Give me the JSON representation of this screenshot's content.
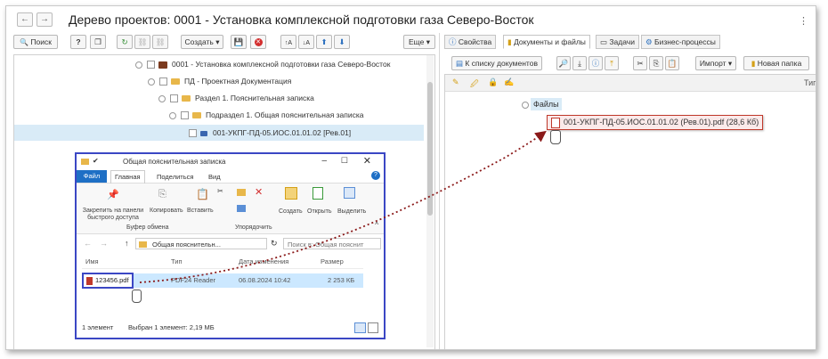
{
  "window": {
    "title": "Дерево проектов: 0001 - Установка комплексной подготовки газа Северо-Восток",
    "nav_back": "←",
    "nav_forward": "→"
  },
  "left_toolbar": {
    "search": "Поиск",
    "help": "?",
    "create": "Создать",
    "more": "Еще"
  },
  "tree": {
    "root": "0001 - Установка комплексной подготовки газа Северо-Восток",
    "pd": "ПД - Проектная Документация",
    "section": "Раздел 1. Пояснительная записка",
    "subsection": "Подраздел 1. Общая пояснительная записка",
    "document": "001-УКПГ-ПД-05.ИОС.01.01.02 [Рев.01]"
  },
  "right_tabs": [
    "Свойства",
    "Документы и файлы",
    "Задачи",
    "Бизнес-процессы"
  ],
  "right_toolbar": {
    "to_list": "К списку документов",
    "import": "Импорт",
    "new_folder": "Новая папка"
  },
  "files": {
    "header": "Файлы",
    "type_col": "Тип",
    "item": "001-УКПГ-ПД-05.ИОС.01.01.02 (Рев.01).pdf (28,6 Кб)"
  },
  "explorer": {
    "title": "Общая пояснительная записка",
    "menu": [
      "Файл",
      "Главная",
      "Поделиться",
      "Вид"
    ],
    "ribbon": {
      "pin": "Закрепить на панели быстрого доступа",
      "copy": "Копировать",
      "paste": "Вставить",
      "create": "Создать",
      "open": "Открыть",
      "select": "Выделить",
      "group_clipboard": "Буфер обмена",
      "group_organize": "Упорядочить"
    },
    "address": "Общая пояснительн...",
    "search_placeholder": "Поиск в: Общая пояснит",
    "columns": [
      "Имя",
      "Тип",
      "Дата изменения",
      "Размер"
    ],
    "file": {
      "name": "123456.pdf",
      "type": "PDF24 Reader",
      "date": "06.08.2024 10:42",
      "size": "2 253 КБ"
    },
    "status_count": "1 элемент",
    "status_selected": "Выбран 1 элемент: 2,19 МБ"
  },
  "colors": {
    "highlight_border": "#3b47c4",
    "file_box_border": "#c0392b",
    "drag_arrow": "#8b1a1a",
    "selected_row": "#d9ebf7",
    "folder": "#e8b74a"
  }
}
